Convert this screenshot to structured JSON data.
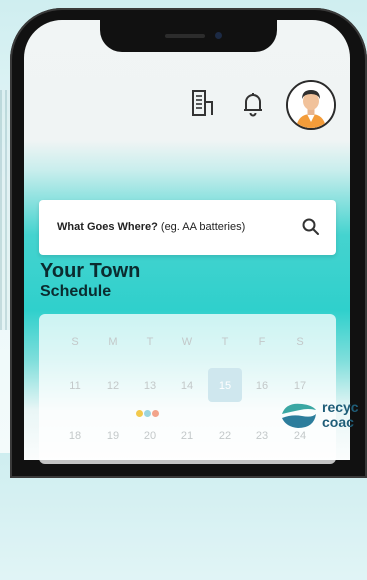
{
  "header": {
    "icons": [
      "building-icon",
      "bell-icon",
      "avatar-icon"
    ]
  },
  "search": {
    "label": "What Goes Where?",
    "placeholder": "(eg. AA batteries)"
  },
  "town": {
    "title": "Your Town",
    "subtitle": "Schedule"
  },
  "calendar": {
    "weekdays": [
      "S",
      "M",
      "T",
      "W",
      "T",
      "F",
      "S"
    ],
    "row1": [
      "11",
      "12",
      "13",
      "14",
      "15",
      "16",
      "17"
    ],
    "row2": [
      "18",
      "19",
      "20",
      "21",
      "22",
      "23",
      "24"
    ],
    "today": "15",
    "dots": [
      "#f2c94c",
      "#9ad5df",
      "#f2a48b"
    ]
  },
  "brand": {
    "line1": "recyc",
    "line2": "coac"
  },
  "colors": {
    "accent": "#2fd0cc",
    "brand": "#1f5d78"
  }
}
